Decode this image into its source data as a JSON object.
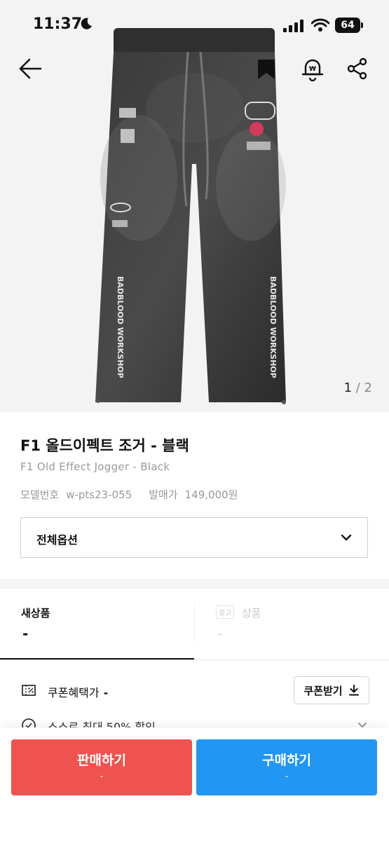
{
  "status": {
    "time": "11:37",
    "battery": "64"
  },
  "gallery": {
    "current": "1",
    "separator": " / ",
    "total": "2"
  },
  "product": {
    "title": "F1 올드이펙트 조거 - 블랙",
    "subtitle": "F1 Old Effect Jogger - Black",
    "model_label": "모델번호",
    "model_value": "w-pts23-055",
    "release_label": "발매가",
    "release_value": "149,000원",
    "print_text": "BADBLOOD WORKSHOP"
  },
  "options": {
    "selected": "전체옵션"
  },
  "tabs": {
    "new_label": "새상품",
    "new_price": "-",
    "used_badge": "중고",
    "used_label": "상품",
    "used_price": "-"
  },
  "coupon": {
    "label": "쿠폰혜택가",
    "value": "-",
    "button_label": "쿠폰받기"
  },
  "promo": {
    "label": "스스로 최대 50% 할인"
  },
  "actions": {
    "sell_label": "판매하기",
    "sell_sub": "-",
    "buy_label": "구매하기",
    "buy_sub": "-"
  },
  "colors": {
    "sell": "#ef5350",
    "buy": "#2196f3"
  },
  "icons": [
    "moon-icon",
    "signal-icon",
    "wifi-icon",
    "back-arrow-icon",
    "bookmark-icon",
    "price-alert-icon",
    "share-icon",
    "chevron-down-icon",
    "coupon-icon",
    "download-icon",
    "promo-icon"
  ]
}
